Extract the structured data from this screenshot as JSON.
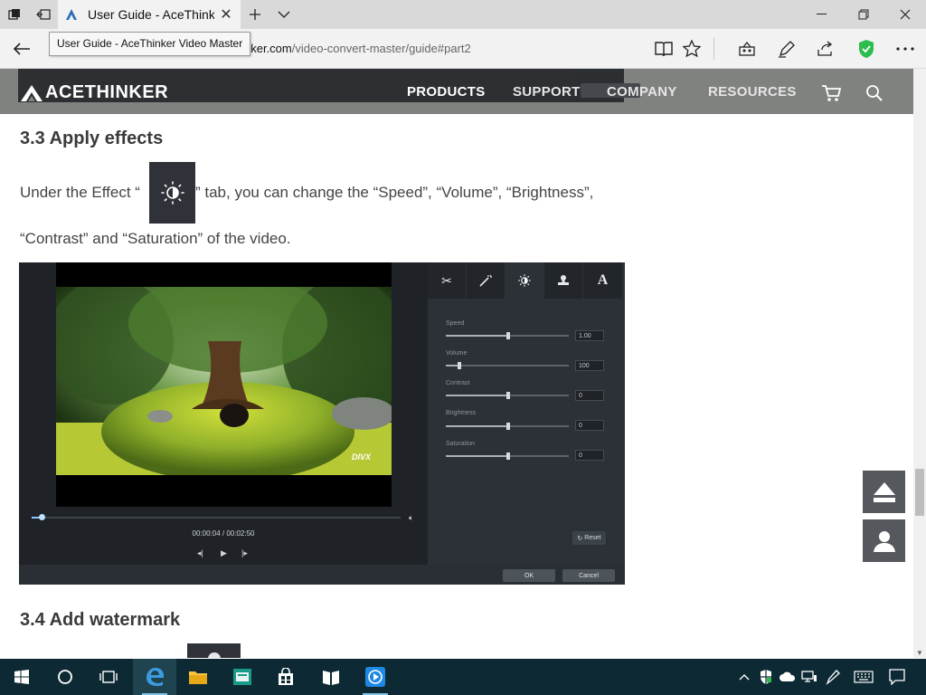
{
  "browser": {
    "tab_title": "User Guide - AceThinke",
    "tooltip": "User Guide - AceThinker Video Master",
    "url_domain": "nker.com",
    "url_path": "/video-convert-master/guide#part2",
    "accent_shield": "#2dbd4e"
  },
  "site": {
    "logo_text": "ACETHINKER",
    "menu": [
      "PRODUCTS",
      "SUPPORT",
      "COMPANY",
      "RESOURCES"
    ]
  },
  "content": {
    "heading_33": "3.3 Apply effects",
    "para_line1": "Under the Effect “",
    "para_line1b": "” tab, you can change the “Speed”, “Volume”, “Brightness”,",
    "para_line2": "“Contrast” and “Saturation” of the video.",
    "heading_34": "3.4 Add watermark"
  },
  "screenshot": {
    "time": "00:00:04 / 00:02:50",
    "watermark": "DIVX",
    "controls": [
      {
        "label": "Speed",
        "value": "1.00",
        "fill": 0.5
      },
      {
        "label": "Volume",
        "value": "100",
        "fill": 0.1
      },
      {
        "label": "Contrast",
        "value": "0",
        "fill": 0.5
      },
      {
        "label": "Brightness",
        "value": "0",
        "fill": 0.5
      },
      {
        "label": "Saturation",
        "value": "0",
        "fill": 0.5
      }
    ],
    "reset_label": "Reset",
    "ok_label": "OK",
    "cancel_label": "Cancel",
    "tab_text_icon": "A"
  }
}
